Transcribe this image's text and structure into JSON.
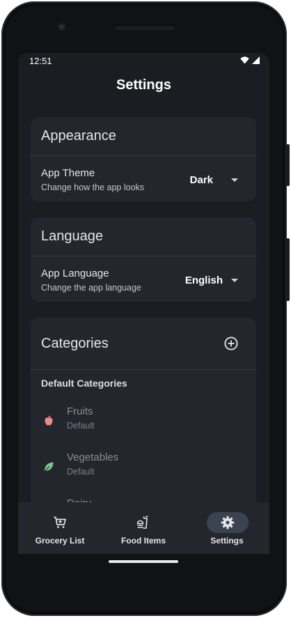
{
  "status_bar": {
    "time": "12:51",
    "wifi_icon": "wifi-icon",
    "signal_icon": "signal-icon"
  },
  "page": {
    "title": "Settings"
  },
  "appearance": {
    "header": "Appearance",
    "theme_label": "App Theme",
    "theme_sub": "Change how the app looks",
    "theme_value": "Dark"
  },
  "language": {
    "header": "Language",
    "label": "App Language",
    "sub": "Change the app language",
    "value": "English"
  },
  "categories": {
    "header": "Categories",
    "add_icon": "add-circle-icon",
    "section": "Default Categories",
    "items": [
      {
        "name": "Fruits",
        "sub": "Default",
        "icon": "apple-icon",
        "color": "#f08a8a"
      },
      {
        "name": "Vegetables",
        "sub": "Default",
        "icon": "leaf-icon",
        "color": "#7fc68a"
      },
      {
        "name": "Dairy",
        "sub": "",
        "icon": "",
        "color": ""
      }
    ]
  },
  "nav": {
    "items": [
      {
        "label": "Grocery List",
        "icon": "cart-icon",
        "active": false
      },
      {
        "label": "Food Items",
        "icon": "food-icon",
        "active": false
      },
      {
        "label": "Settings",
        "icon": "gear-icon",
        "active": true
      }
    ]
  },
  "colors": {
    "background": "#1b1d22",
    "card": "#23262c",
    "active_pill": "#3b4350"
  }
}
